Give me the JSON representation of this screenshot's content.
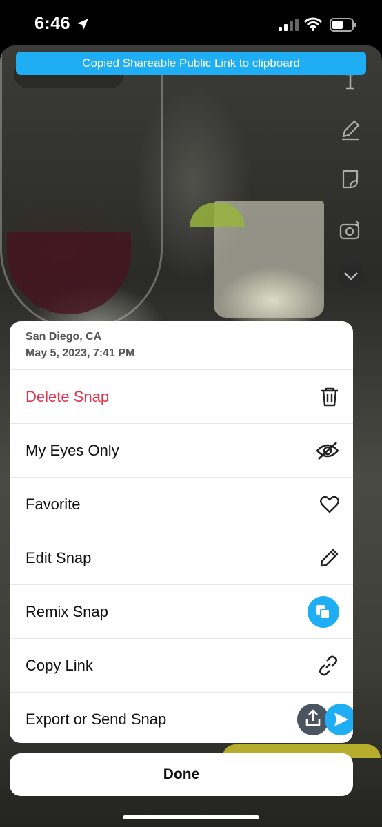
{
  "status_bar": {
    "time": "6:46"
  },
  "toast": {
    "text": "Copied Shareable Public Link to clipboard"
  },
  "sheet": {
    "location": "San Diego, CA",
    "datetime": "May 5, 2023, 7:41 PM",
    "items": [
      {
        "label": "Delete Snap",
        "icon": "trash-icon"
      },
      {
        "label": "My Eyes Only",
        "icon": "eye-slash-icon"
      },
      {
        "label": "Favorite",
        "icon": "heart-icon"
      },
      {
        "label": "Edit Snap",
        "icon": "pencil-icon"
      },
      {
        "label": "Remix Snap",
        "icon": "remix-icon"
      },
      {
        "label": "Copy Link",
        "icon": "link-icon"
      },
      {
        "label": "Export or Send Snap",
        "icon": "export-send-icons"
      }
    ]
  },
  "done_label": "Done",
  "colors": {
    "accent": "#1faef4",
    "danger": "#e0354f"
  }
}
